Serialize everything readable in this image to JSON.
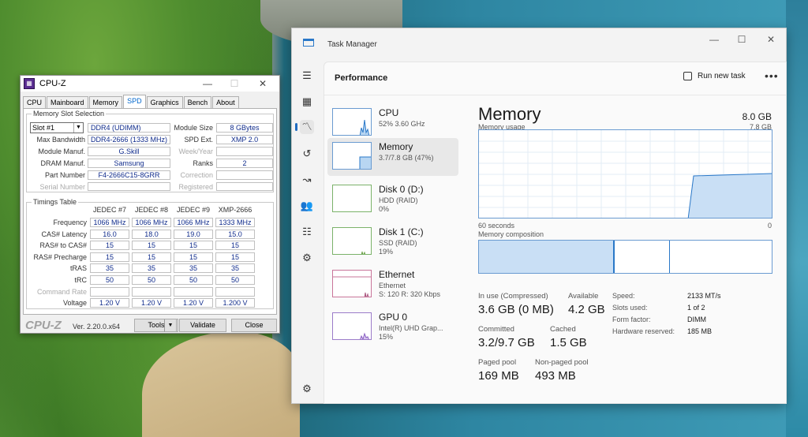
{
  "cpuz": {
    "title": "CPU-Z",
    "tabs": [
      "CPU",
      "Mainboard",
      "Memory",
      "SPD",
      "Graphics",
      "Bench",
      "About"
    ],
    "active_tab": "SPD",
    "slot_group": "Memory Slot Selection",
    "slot_select": "Slot #1",
    "module_type": "DDR4 (UDIMM)",
    "module_size_label": "Module Size",
    "module_size": "8 GBytes",
    "max_bw_label": "Max Bandwidth",
    "max_bw": "DDR4-2666 (1333 MHz)",
    "spd_ext_label": "SPD Ext.",
    "spd_ext": "XMP 2.0",
    "module_manuf_label": "Module Manuf.",
    "module_manuf": "G.Skill",
    "week_year_label": "Week/Year",
    "dram_manuf_label": "DRAM Manuf.",
    "dram_manuf": "Samsung",
    "ranks_label": "Ranks",
    "ranks": "2",
    "part_label": "Part Number",
    "part": "F4-2666C15-8GRR",
    "correction_label": "Correction",
    "serial_label": "Serial Number",
    "registered_label": "Registered",
    "timings_group": "Timings Table",
    "columns": [
      "JEDEC #7",
      "JEDEC #8",
      "JEDEC #9",
      "XMP-2666"
    ],
    "rows": [
      {
        "label": "Frequency",
        "values": [
          "1066 MHz",
          "1066 MHz",
          "1066 MHz",
          "1333 MHz"
        ]
      },
      {
        "label": "CAS# Latency",
        "values": [
          "16.0",
          "18.0",
          "19.0",
          "15.0"
        ]
      },
      {
        "label": "RAS# to CAS#",
        "values": [
          "15",
          "15",
          "15",
          "15"
        ]
      },
      {
        "label": "RAS# Precharge",
        "values": [
          "15",
          "15",
          "15",
          "15"
        ]
      },
      {
        "label": "tRAS",
        "values": [
          "35",
          "35",
          "35",
          "35"
        ]
      },
      {
        "label": "tRC",
        "values": [
          "50",
          "50",
          "50",
          "50"
        ]
      },
      {
        "label": "Command Rate",
        "values": [
          "",
          "",
          "",
          ""
        ]
      },
      {
        "label": "Voltage",
        "values": [
          "1.20 V",
          "1.20 V",
          "1.20 V",
          "1.200 V"
        ]
      }
    ],
    "brand": "CPU-Z",
    "version": "Ver. 2.20.0.x64",
    "tools_label": "Tools",
    "validate_label": "Validate",
    "close_label": "Close"
  },
  "tm": {
    "title": "Task Manager",
    "header": "Performance",
    "run_new_task": "Run new task",
    "more": "•••",
    "resources": [
      {
        "name": "CPU",
        "sub1": "52%  3.60 GHz",
        "sub2": ""
      },
      {
        "name": "Memory",
        "sub1": "3.7/7.8 GB (47%)",
        "sub2": ""
      },
      {
        "name": "Disk 0 (D:)",
        "sub1": "HDD (RAID)",
        "sub2": "0%"
      },
      {
        "name": "Disk 1 (C:)",
        "sub1": "SSD (RAID)",
        "sub2": "19%"
      },
      {
        "name": "Ethernet",
        "sub1": "Ethernet",
        "sub2": "S: 120  R: 320 Kbps"
      },
      {
        "name": "GPU 0",
        "sub1": "Intel(R) UHD Grap...",
        "sub2": "15%"
      }
    ],
    "detail": {
      "title": "Memory",
      "total": "8.0 GB",
      "usage_label": "Memory usage",
      "usage_max": "7.8 GB",
      "time_left": "60 seconds",
      "time_right": "0",
      "composition_label": "Memory composition",
      "in_use_label": "In use (Compressed)",
      "in_use": "3.6 GB (0 MB)",
      "available_label": "Available",
      "available": "4.2 GB",
      "committed_label": "Committed",
      "committed": "3.2/9.7 GB",
      "cached_label": "Cached",
      "cached": "1.5 GB",
      "paged_label": "Paged pool",
      "paged": "169 MB",
      "nonpaged_label": "Non-paged pool",
      "nonpaged": "493 MB",
      "speed_label": "Speed:",
      "speed": "2133 MT/s",
      "slots_label": "Slots used:",
      "slots": "1 of 2",
      "form_label": "Form factor:",
      "form": "DIMM",
      "hwres_label": "Hardware reserved:",
      "hwres": "185 MB"
    }
  }
}
